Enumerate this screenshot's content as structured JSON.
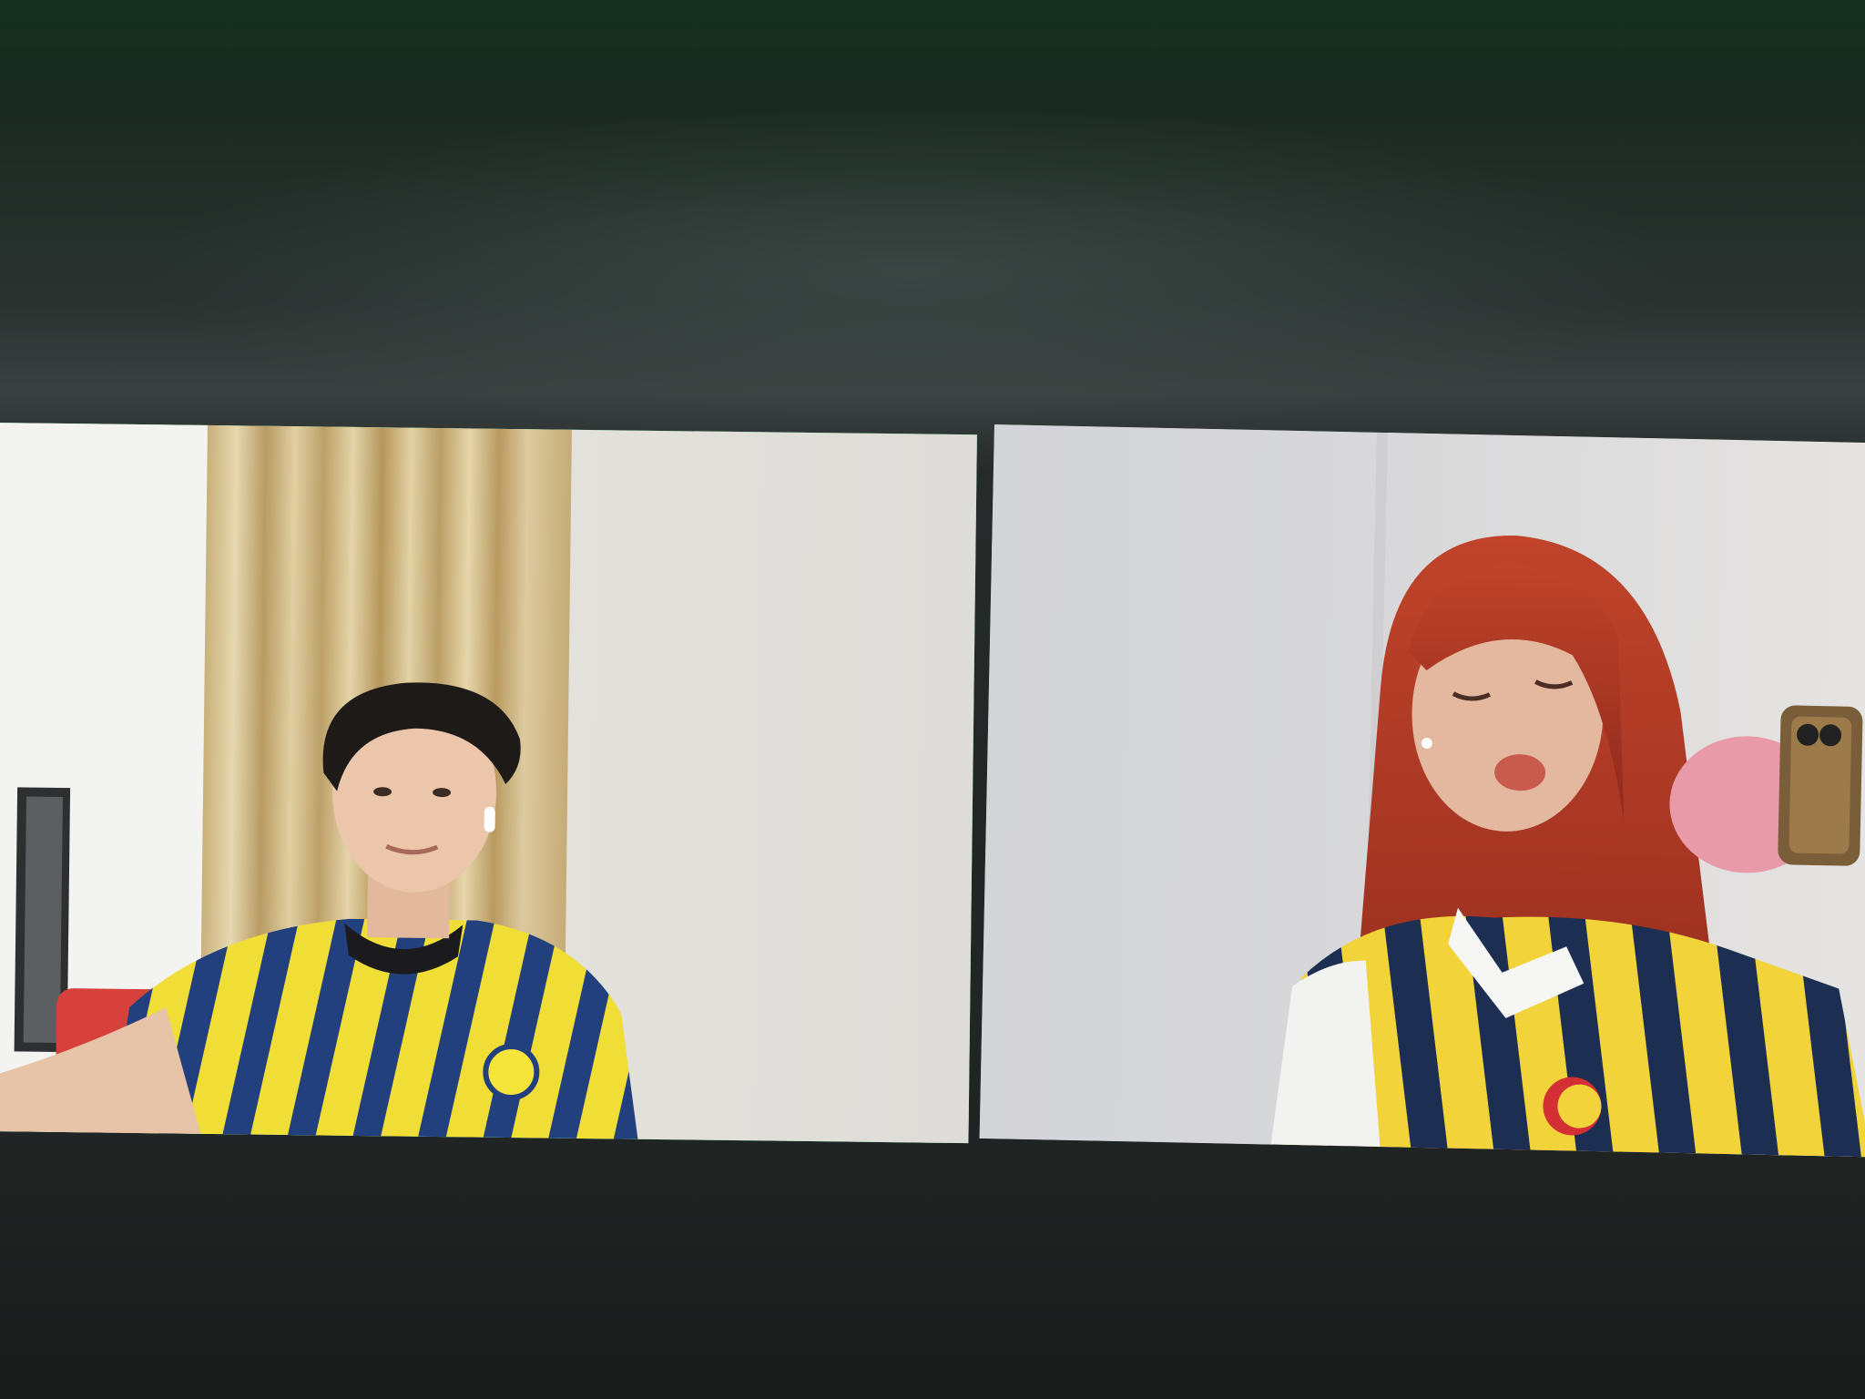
{
  "app": {
    "name": "",
    "theme": "dark"
  },
  "colors": {
    "background": "#1f2623",
    "active_speaker_border": "#2fd36a",
    "jersey_yellow": "#f2e13a",
    "jersey_navy": "#1f3a78",
    "hair_red": "#b73b24"
  },
  "participants": [
    {
      "name": "",
      "active_speaker": true,
      "video_on": true
    },
    {
      "name": "",
      "active_speaker": false,
      "video_on": true
    }
  ]
}
